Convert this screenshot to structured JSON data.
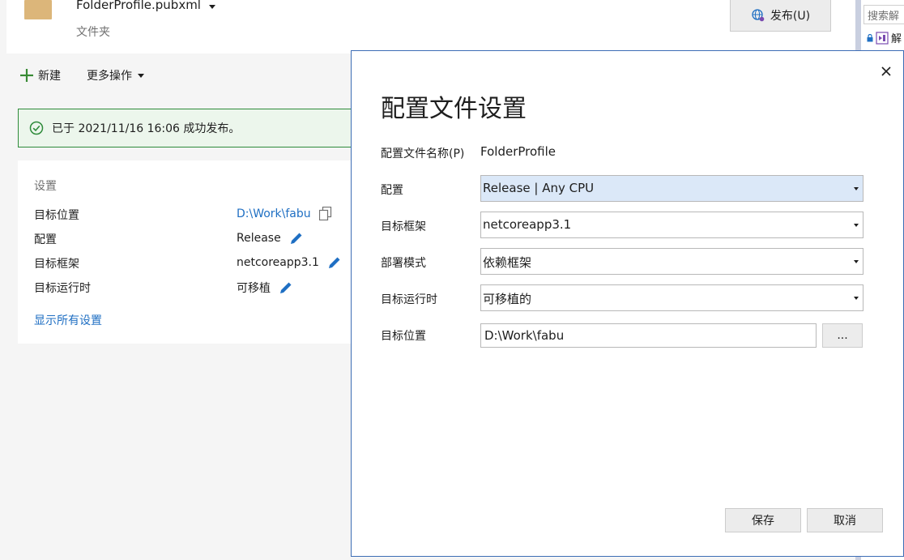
{
  "header": {
    "profile_name": "FolderProfile.pubxml",
    "profile_type": "文件夹",
    "publish_label": "发布(U)"
  },
  "solution_explorer": {
    "search_placeholder": "搜索解",
    "item_label": "解"
  },
  "toolbar": {
    "new_label": "新建",
    "more_label": "更多操作"
  },
  "banner": {
    "message": "已于 2021/11/16 16:06 成功发布。"
  },
  "settings": {
    "title": "设置",
    "rows": [
      {
        "key": "目标位置",
        "value": "D:\\Work\\fabu"
      },
      {
        "key": "配置",
        "value": "Release"
      },
      {
        "key": "目标框架",
        "value": "netcoreapp3.1"
      },
      {
        "key": "目标运行时",
        "value": "可移植"
      }
    ],
    "show_all": "显示所有设置"
  },
  "dialog": {
    "title": "配置文件设置",
    "profile_name_label": "配置文件名称(P)",
    "profile_name_value": "FolderProfile",
    "configuration_label": "配置",
    "configuration_value": "Release | Any CPU",
    "framework_label": "目标框架",
    "framework_value": "netcoreapp3.1",
    "deploy_mode_label": "部署模式",
    "deploy_mode_value": "依赖框架",
    "runtime_label": "目标运行时",
    "runtime_value": "可移植的",
    "location_label": "目标位置",
    "location_value": "D:\\Work\\fabu",
    "browse_label": "...",
    "save_label": "保存",
    "cancel_label": "取消"
  },
  "colors": {
    "accent": "#1f6fc3",
    "success": "#2e8b3a",
    "dialog_border": "#3d6db5"
  }
}
